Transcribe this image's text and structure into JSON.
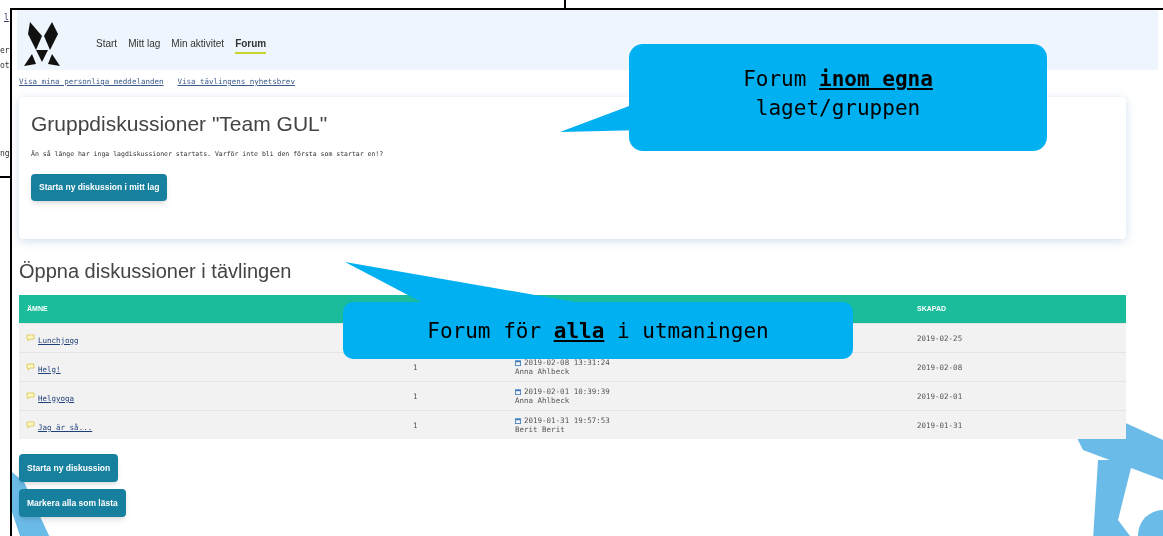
{
  "background_window": {
    "fragments": [
      "l",
      "er",
      "ot",
      "ng"
    ]
  },
  "nav": [
    {
      "label": "Start",
      "selected": false
    },
    {
      "label": "Mitt lag",
      "selected": false
    },
    {
      "label": "Min aktivitet",
      "selected": false
    },
    {
      "label": "Forum",
      "selected": true
    }
  ],
  "links": [
    "Visa mina personliga meddelanden",
    "Visa tävlingens nyhetsbrev"
  ],
  "group": {
    "title": "Gruppdiskussioner \"Team GUL\"",
    "message": "Än så länge har inga lagdiskussioner startats. Varför inte bli den första som startar en!?",
    "button": "Starta ny diskussion i mitt lag"
  },
  "open": {
    "title": "Öppna diskussioner i tävlingen",
    "table": {
      "header": {
        "subject": "ÄMNE",
        "created": "SKAPAD"
      },
      "rows": [
        {
          "subject": "Lunchjogg",
          "created": "2019-02-25"
        },
        {
          "subject": "Helg!",
          "column_2": "1",
          "last_post": {
            "date": "2019-02-08 13:31:24",
            "author": "Anna Ahlbeck"
          },
          "created": "2019-02-08"
        },
        {
          "subject": "Helgyoga",
          "column_2": "1",
          "last_post": {
            "date": "2019-02-01 10:39:39",
            "author": "Anna Ahlbeck"
          },
          "created": "2019-02-01"
        },
        {
          "subject": "Jag är så...",
          "column_2": "1",
          "last_post": {
            "date": "2019-01-31 19:57:53",
            "author": "Berit Berit"
          },
          "created": "2019-01-31"
        }
      ]
    },
    "buttons": [
      "Starta ny diskussion",
      "Markera alla som lästa"
    ]
  },
  "callouts": [
    {
      "lines": [
        "Forum **inom egna**",
        "laget/gruppen"
      ]
    },
    {
      "lines": [
        "Forum för **alla** i utmaningen"
      ]
    }
  ]
}
